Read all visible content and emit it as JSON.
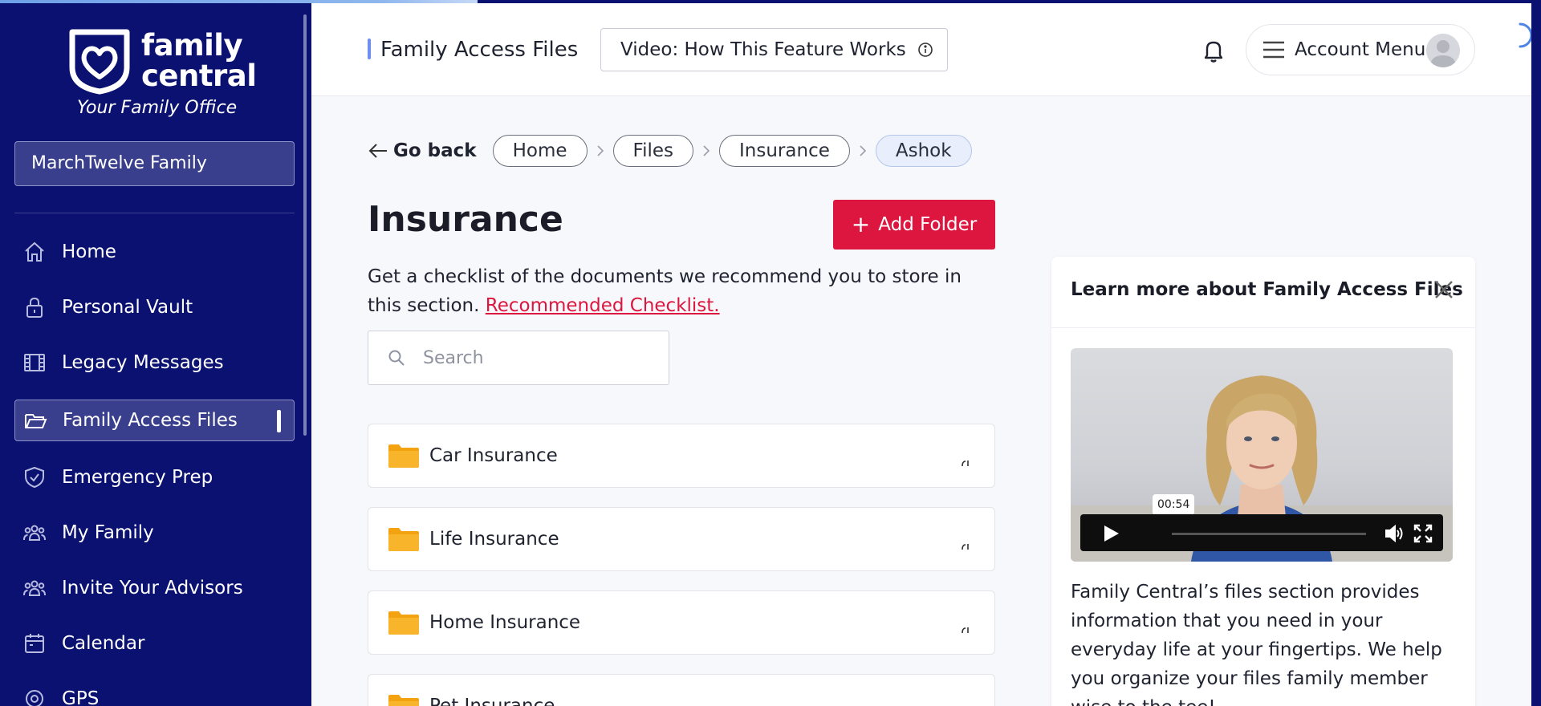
{
  "app": {
    "brand_word_1": "family",
    "brand_word_2": "central",
    "tagline": "Your Family Office",
    "accent_color": "#dd1640",
    "sidebar_color": "#0b1170"
  },
  "sidebar": {
    "family_selector": "MarchTwelve Family",
    "items": [
      {
        "label": "Home",
        "icon": "home-icon"
      },
      {
        "label": "Personal Vault",
        "icon": "lock-icon"
      },
      {
        "label": "Legacy Messages",
        "icon": "film-icon"
      },
      {
        "label": "Family Access Files",
        "icon": "folder-open-icon",
        "active": true
      },
      {
        "label": "Emergency Prep",
        "icon": "shield-check-icon"
      },
      {
        "label": "My Family",
        "icon": "people-icon"
      },
      {
        "label": "Invite Your Advisors",
        "icon": "people-icon"
      },
      {
        "label": "Calendar",
        "icon": "calendar-icon"
      },
      {
        "label": "GPS",
        "icon": "location-icon"
      }
    ]
  },
  "header": {
    "title": "Family Access Files",
    "video_button": "Video: How This Feature Works",
    "account_menu": "Account Menu"
  },
  "breadcrumb": {
    "back": "Go back",
    "items": [
      "Home",
      "Files",
      "Insurance",
      "Ashok"
    ]
  },
  "main": {
    "heading": "Insurance",
    "add_folder": "Add Folder",
    "description": "Get a checklist of the documents we recommend you to store in this section.",
    "checklist_link": "Recommended Checklist.",
    "search_placeholder": "Search",
    "folders": [
      "Car Insurance",
      "Life Insurance",
      "Home Insurance",
      "Pet Insurance"
    ]
  },
  "panel": {
    "title": "Learn more about Family Access Files",
    "video_time": "00:54",
    "body": "Family Central’s files section provides information that you need in your everyday life at your fingertips. We help you organize your files family member wise to the tee!"
  }
}
